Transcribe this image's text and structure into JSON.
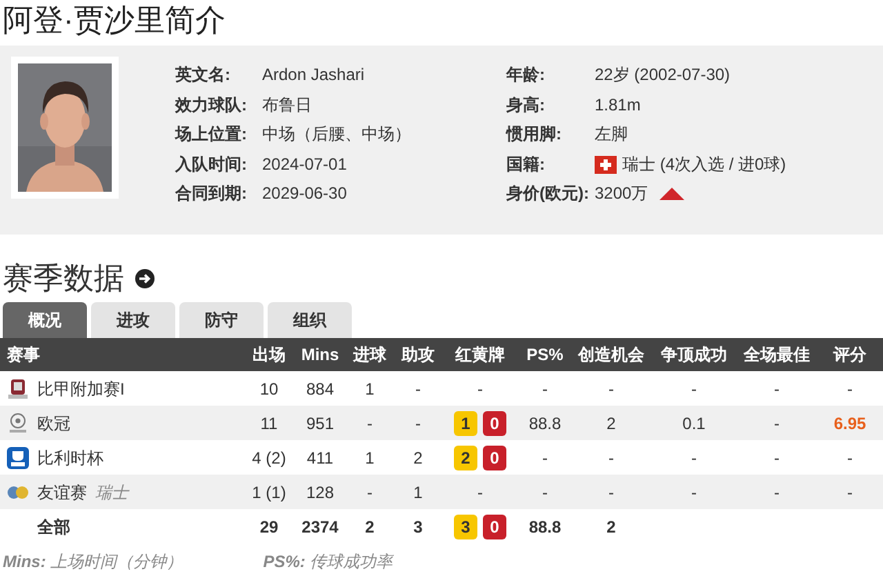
{
  "title": "阿登·贾沙里简介",
  "profile": {
    "left": [
      {
        "label": "英文名:",
        "value": "Ardon Jashari"
      },
      {
        "label": "效力球队:",
        "value": "布鲁日"
      },
      {
        "label": "场上位置:",
        "value": "中场（后腰、中场）"
      },
      {
        "label": "入队时间:",
        "value": "2024-07-01"
      },
      {
        "label": "合同到期:",
        "value": "2029-06-30"
      }
    ],
    "right": [
      {
        "label": "年龄:",
        "value": "22岁  (2002-07-30)",
        "kind": "text"
      },
      {
        "label": "身高:",
        "value": "1.81m",
        "kind": "text"
      },
      {
        "label": "惯用脚:",
        "value": "左脚",
        "kind": "text"
      },
      {
        "label": "国籍:",
        "value": "瑞士 (4次入选 / 进0球)",
        "kind": "flag"
      },
      {
        "label": "身价(欧元):",
        "value": "3200万",
        "kind": "trend"
      }
    ]
  },
  "section": {
    "title": "赛季数据"
  },
  "tabs": [
    {
      "label": "概况",
      "selected": true
    },
    {
      "label": "进攻",
      "selected": false
    },
    {
      "label": "防守",
      "selected": false
    },
    {
      "label": "组织",
      "selected": false
    }
  ],
  "table": {
    "columns": [
      "赛事",
      "出场",
      "Mins",
      "进球",
      "助攻",
      "红黄牌",
      "PS%",
      "创造机会",
      "争顶成功",
      "全场最佳",
      "评分"
    ],
    "rows": [
      {
        "total": false,
        "cells": [
          "比甲附加赛I",
          "10",
          "884",
          "1",
          "-",
          "-",
          "-",
          "-",
          "-",
          "-",
          {
            "text": "-",
            "color": "#333333"
          }
        ]
      },
      {
        "total": false,
        "cells": [
          "欧冠",
          "11",
          "951",
          "-",
          "-",
          {
            "yellow": "1",
            "red": "0"
          },
          "88.8",
          "2",
          "0.1",
          "-",
          {
            "text": "6.95",
            "color": "#e8601c"
          }
        ]
      },
      {
        "total": false,
        "cells": [
          "比利时杯",
          "4 (2)",
          "411",
          "1",
          "2",
          {
            "yellow": "2",
            "red": "0"
          },
          "-",
          "-",
          "-",
          "-",
          {
            "text": "-",
            "color": "#333333"
          }
        ]
      },
      {
        "total": false,
        "subtitle": "瑞士",
        "cells": [
          "友谊赛",
          "1 (1)",
          "128",
          "-",
          "1",
          "-",
          "-",
          "-",
          "-",
          "-",
          {
            "text": "-",
            "color": "#333333"
          }
        ]
      },
      {
        "total": true,
        "cells": [
          "全部",
          "29",
          "2374",
          "2",
          "3",
          {
            "yellow": "3",
            "red": "0"
          },
          "88.8",
          "2"
        ]
      }
    ]
  },
  "notes": [
    {
      "key": "Mins:",
      "text": "上场时间（分钟）"
    },
    {
      "key": "PS%:",
      "text": "传球成功率"
    }
  ]
}
